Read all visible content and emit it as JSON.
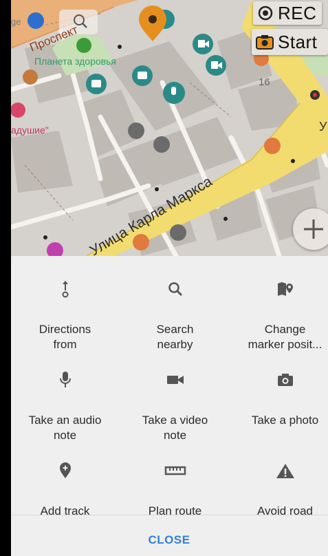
{
  "map": {
    "street_main": "Улица Карла Маркса",
    "street_top": "Проспект",
    "poi_pharmacy": "Планета здоровья",
    "poi_shop": "адушие\"",
    "house_number": "16",
    "edge_text_left": "ge",
    "edge_text_right": "У"
  },
  "overlay": {
    "rec_label": "REC",
    "start_label": "Start"
  },
  "actions": [
    {
      "icon": "directions-from-icon",
      "label": "Directions\nfrom"
    },
    {
      "icon": "search-icon",
      "label": "Search\nnearby"
    },
    {
      "icon": "change-marker-icon",
      "label": "Change\nmarker posit..."
    },
    {
      "icon": "microphone-icon",
      "label": "Take an audio\nnote"
    },
    {
      "icon": "video-camera-icon",
      "label": "Take a video\nnote"
    },
    {
      "icon": "camera-icon",
      "label": "Take a photo"
    },
    {
      "icon": "add-track-pin-icon",
      "label": "Add track"
    },
    {
      "icon": "ruler-icon",
      "label": "Plan route"
    },
    {
      "icon": "warning-icon",
      "label": "Avoid road"
    }
  ],
  "close_label": "CLOSE",
  "colors": {
    "sheet_bg": "#efefef",
    "accent": "#2f82d6",
    "marker": "#e58f1f",
    "road_primary": "#f2dc6f",
    "poi_teal": "#2a8a87"
  }
}
